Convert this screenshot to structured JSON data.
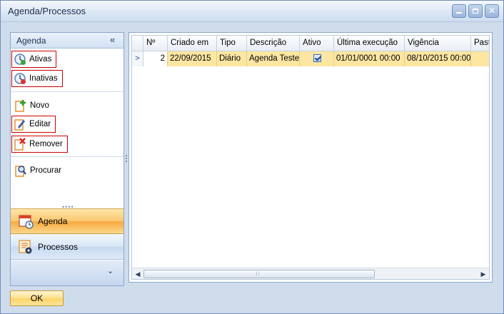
{
  "window": {
    "title": "Agenda/Processos"
  },
  "nav": {
    "header": "Agenda",
    "items": [
      {
        "label": "Ativas",
        "icon": "clock-ativas-icon"
      },
      {
        "label": "Inativas",
        "icon": "clock-inativas-icon"
      },
      {
        "label": "Novo",
        "icon": "new-document-icon"
      },
      {
        "label": "Editar",
        "icon": "edit-pencil-icon"
      },
      {
        "label": "Remover",
        "icon": "remove-x-icon"
      },
      {
        "label": "Procurar",
        "icon": "search-icon"
      }
    ],
    "groups": [
      {
        "label": "Agenda",
        "icon": "calendar-icon",
        "active": true
      },
      {
        "label": "Processos",
        "icon": "list-process-icon",
        "active": false
      }
    ]
  },
  "grid": {
    "columns": [
      "Nº",
      "Criado em",
      "Tipo",
      "Descrição",
      "Ativo",
      "Última execução",
      "Vigência",
      "Past"
    ],
    "rows": [
      {
        "num": "2",
        "criado_em": "22/09/2015",
        "tipo": "Diário",
        "descricao": "Agenda Teste",
        "ativo": true,
        "ultima_execucao": "01/01/0001 00:00",
        "vigencia": "08/10/2015 00:00",
        "past": ""
      }
    ]
  },
  "footer": {
    "ok_label": "OK"
  },
  "colors": {
    "highlight_row": "#fde6a2",
    "active_group": "#fbc770",
    "frame": "#cfdcec"
  }
}
